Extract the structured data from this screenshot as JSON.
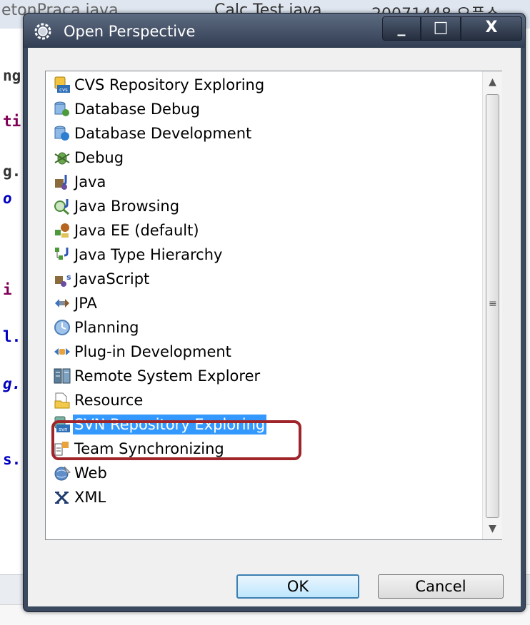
{
  "background": {
    "tabs": [
      "etonPraca.java",
      "Calc Test.java",
      "20071448 오픈소"
    ],
    "editor_fragments": [
      "ng",
      "ti",
      "g.",
      "o",
      "i",
      "l.",
      "g.",
      "s."
    ]
  },
  "dialog": {
    "title": "Open Perspective",
    "window_controls": {
      "minimize": "_",
      "maximize": "□",
      "close": "X"
    },
    "perspectives": [
      {
        "label": "CVS Repository Exploring",
        "icon": "cvs-repository-icon"
      },
      {
        "label": "Database Debug",
        "icon": "database-debug-icon"
      },
      {
        "label": "Database Development",
        "icon": "database-development-icon"
      },
      {
        "label": "Debug",
        "icon": "debug-bug-icon"
      },
      {
        "label": "Java",
        "icon": "java-perspective-icon"
      },
      {
        "label": "Java Browsing",
        "icon": "java-browsing-icon"
      },
      {
        "label": "Java EE (default)",
        "icon": "java-ee-icon"
      },
      {
        "label": "Java Type Hierarchy",
        "icon": "java-type-hierarchy-icon"
      },
      {
        "label": "JavaScript",
        "icon": "javascript-icon"
      },
      {
        "label": "JPA",
        "icon": "jpa-icon"
      },
      {
        "label": "Planning",
        "icon": "planning-icon"
      },
      {
        "label": "Plug-in Development",
        "icon": "plugin-development-icon"
      },
      {
        "label": "Remote System Explorer",
        "icon": "remote-system-explorer-icon"
      },
      {
        "label": "Resource",
        "icon": "resource-icon"
      },
      {
        "label": "SVN Repository Exploring",
        "icon": "svn-repository-icon",
        "selected": true
      },
      {
        "label": "Team Synchronizing",
        "icon": "team-synchronizing-icon"
      },
      {
        "label": "Web",
        "icon": "web-icon"
      },
      {
        "label": "XML",
        "icon": "xml-icon"
      }
    ],
    "ok_label": "OK",
    "cancel_label": "Cancel"
  },
  "colors": {
    "selection": "#3399ff",
    "annotation_outline": "#a0252a",
    "titlebar": "#3c4a60"
  }
}
